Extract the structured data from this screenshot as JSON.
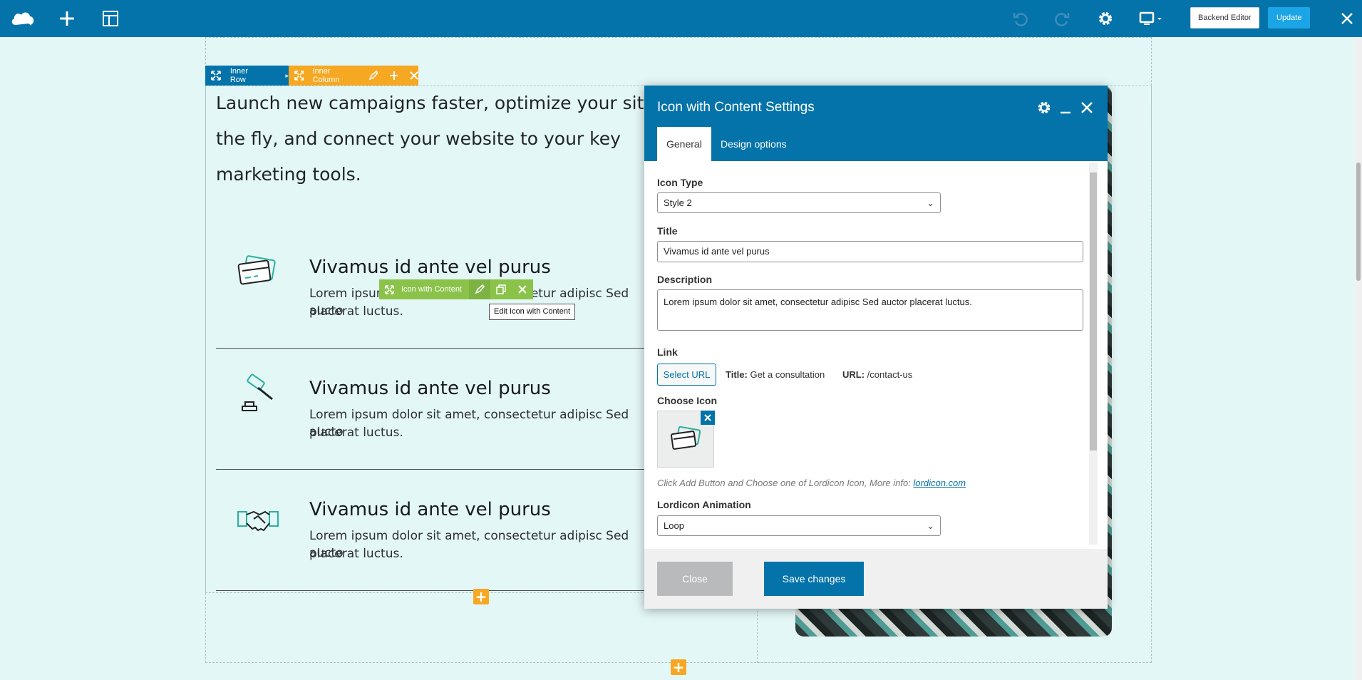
{
  "topbar": {
    "logo_icon": "cloud-logo-icon",
    "add_icon": "plus-icon",
    "templates_icon": "layout-icon",
    "undo_icon": "undo-icon",
    "redo_icon": "redo-icon",
    "settings_icon": "gear-icon",
    "responsive_icon": "monitor-icon",
    "backend_editor_label": "Backend Editor",
    "update_label": "Update",
    "close_icon": "close-icon"
  },
  "controls": {
    "inner_row_label": "Inner Row",
    "inner_column_label": "Inner Column",
    "element_label": "Icon with Content",
    "tooltip": "Edit Icon with Content"
  },
  "page": {
    "intro_lines": [
      "Launch new campaigns faster, optimize your sit",
      "the fly, and connect your website to your key",
      "marketing tools."
    ],
    "features": [
      {
        "title": "Vivamus id ante vel purus",
        "desc_line1": "Lorem ipsum dolor sit amet, consectetur adipisc Sed aucto",
        "desc_line2": "placerat luctus.",
        "icon": "credit-cards-icon"
      },
      {
        "title": "Vivamus id ante vel purus",
        "desc_line1": "Lorem ipsum dolor sit amet, consectetur adipisc Sed aucto",
        "desc_line2": "placerat luctus.",
        "icon": "gavel-icon"
      },
      {
        "title": "Vivamus id ante vel purus",
        "desc_line1": "Lorem ipsum dolor sit amet, consectetur adipisc Sed aucto",
        "desc_line2": "placerat luctus.",
        "icon": "handshake-icon"
      }
    ]
  },
  "modal": {
    "title": "Icon with Content Settings",
    "tabs": [
      "General",
      "Design options"
    ],
    "icon_type_label": "Icon Type",
    "icon_type_value": "Style 2",
    "title_label": "Title",
    "title_value": "Vivamus id ante vel purus",
    "description_label": "Description",
    "description_value": "Lorem ipsum dolor sit amet, consectetur adipisc Sed auctor placerat luctus.",
    "link_label": "Link",
    "select_url_label": "Select URL",
    "link_title_key": "Title:",
    "link_title_value": "Get a consultation",
    "link_url_key": "URL:",
    "link_url_value": "/contact-us",
    "choose_icon_label": "Choose Icon",
    "hint_text": "Click Add Button and Choose one of Lordicon Icon, More info:",
    "hint_link": "lordicon.com",
    "animation_label": "Lordicon Animation",
    "animation_value": "Loop",
    "close_label": "Close",
    "save_label": "Save changes"
  }
}
